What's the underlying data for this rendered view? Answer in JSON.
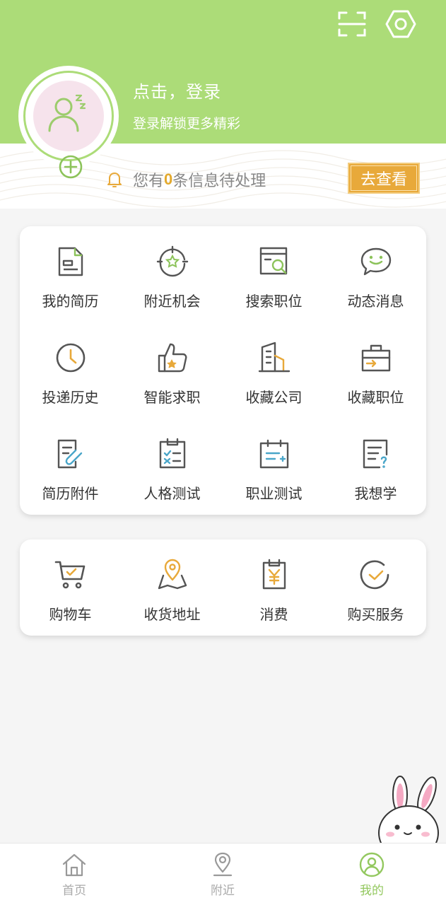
{
  "header": {
    "login_title": "点击，登录",
    "login_subtitle": "登录解锁更多精彩",
    "bg_color": "#acdc78"
  },
  "notice": {
    "prefix": "您有",
    "count": "0",
    "suffix": "条信息待处理",
    "button_label": "去查看",
    "accent_color": "#e8a93a"
  },
  "job_menu": {
    "items": [
      {
        "label": "我的简历",
        "icon": "resume-icon"
      },
      {
        "label": "附近机会",
        "icon": "nearby-target-icon"
      },
      {
        "label": "搜索职位",
        "icon": "search-job-icon"
      },
      {
        "label": "动态消息",
        "icon": "chat-bubble-icon"
      },
      {
        "label": "投递历史",
        "icon": "clock-icon"
      },
      {
        "label": "智能求职",
        "icon": "thumbs-up-icon"
      },
      {
        "label": "收藏公司",
        "icon": "building-icon"
      },
      {
        "label": "收藏职位",
        "icon": "briefcase-icon"
      },
      {
        "label": "简历附件",
        "icon": "attachment-icon"
      },
      {
        "label": "人格测试",
        "icon": "checklist-icon"
      },
      {
        "label": "职业测试",
        "icon": "calendar-test-icon"
      },
      {
        "label": "我想学",
        "icon": "question-doc-icon"
      }
    ]
  },
  "shop_menu": {
    "items": [
      {
        "label": "购物车",
        "icon": "cart-icon"
      },
      {
        "label": "收货地址",
        "icon": "map-pin-icon"
      },
      {
        "label": "消费",
        "icon": "yen-clipboard-icon"
      },
      {
        "label": "购买服务",
        "icon": "check-circle-icon"
      }
    ]
  },
  "tabbar": {
    "tabs": [
      {
        "label": "首页",
        "icon": "home-icon",
        "active": false
      },
      {
        "label": "附近",
        "icon": "location-icon",
        "active": false
      },
      {
        "label": "我的",
        "icon": "profile-icon",
        "active": true
      }
    ],
    "active_color": "#93c85f",
    "inactive_color": "#aaaaaa"
  }
}
